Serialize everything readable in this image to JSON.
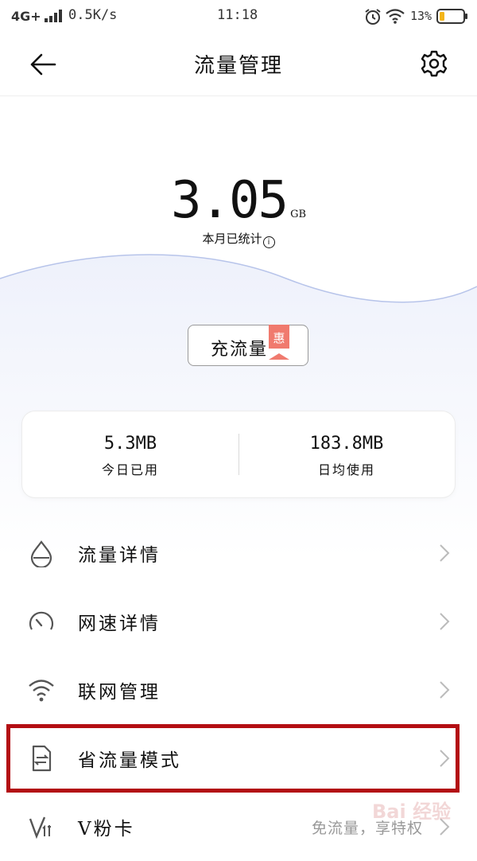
{
  "status_bar": {
    "network": "4G+",
    "speed": "0.5K/s",
    "time": "11:18",
    "battery": "13%"
  },
  "header": {
    "title": "流量管理"
  },
  "usage": {
    "value": "3.05",
    "unit": "GB",
    "label": "本月已统计"
  },
  "topup": {
    "label": "充流量",
    "badge": "惠"
  },
  "stats": {
    "today_value": "5.3MB",
    "today_label": "今日已用",
    "avg_value": "183.8MB",
    "avg_label": "日均使用"
  },
  "menu": {
    "items": [
      {
        "label": "流量详情",
        "icon": "droplet-icon"
      },
      {
        "label": "网速详情",
        "icon": "speedometer-icon"
      },
      {
        "label": "联网管理",
        "icon": "wifi-icon"
      },
      {
        "label": "省流量模式",
        "icon": "data-saver-icon"
      },
      {
        "label": "V粉卡",
        "icon": "v-card-icon",
        "sub": "免流量，享特权"
      }
    ]
  },
  "watermark": "Bai 经验",
  "colors": {
    "accent_badge": "#f07a6e",
    "highlight_border": "#b30e13",
    "wave_fill": "#f3f5fd",
    "wave_stroke": "#b7c4ea"
  }
}
